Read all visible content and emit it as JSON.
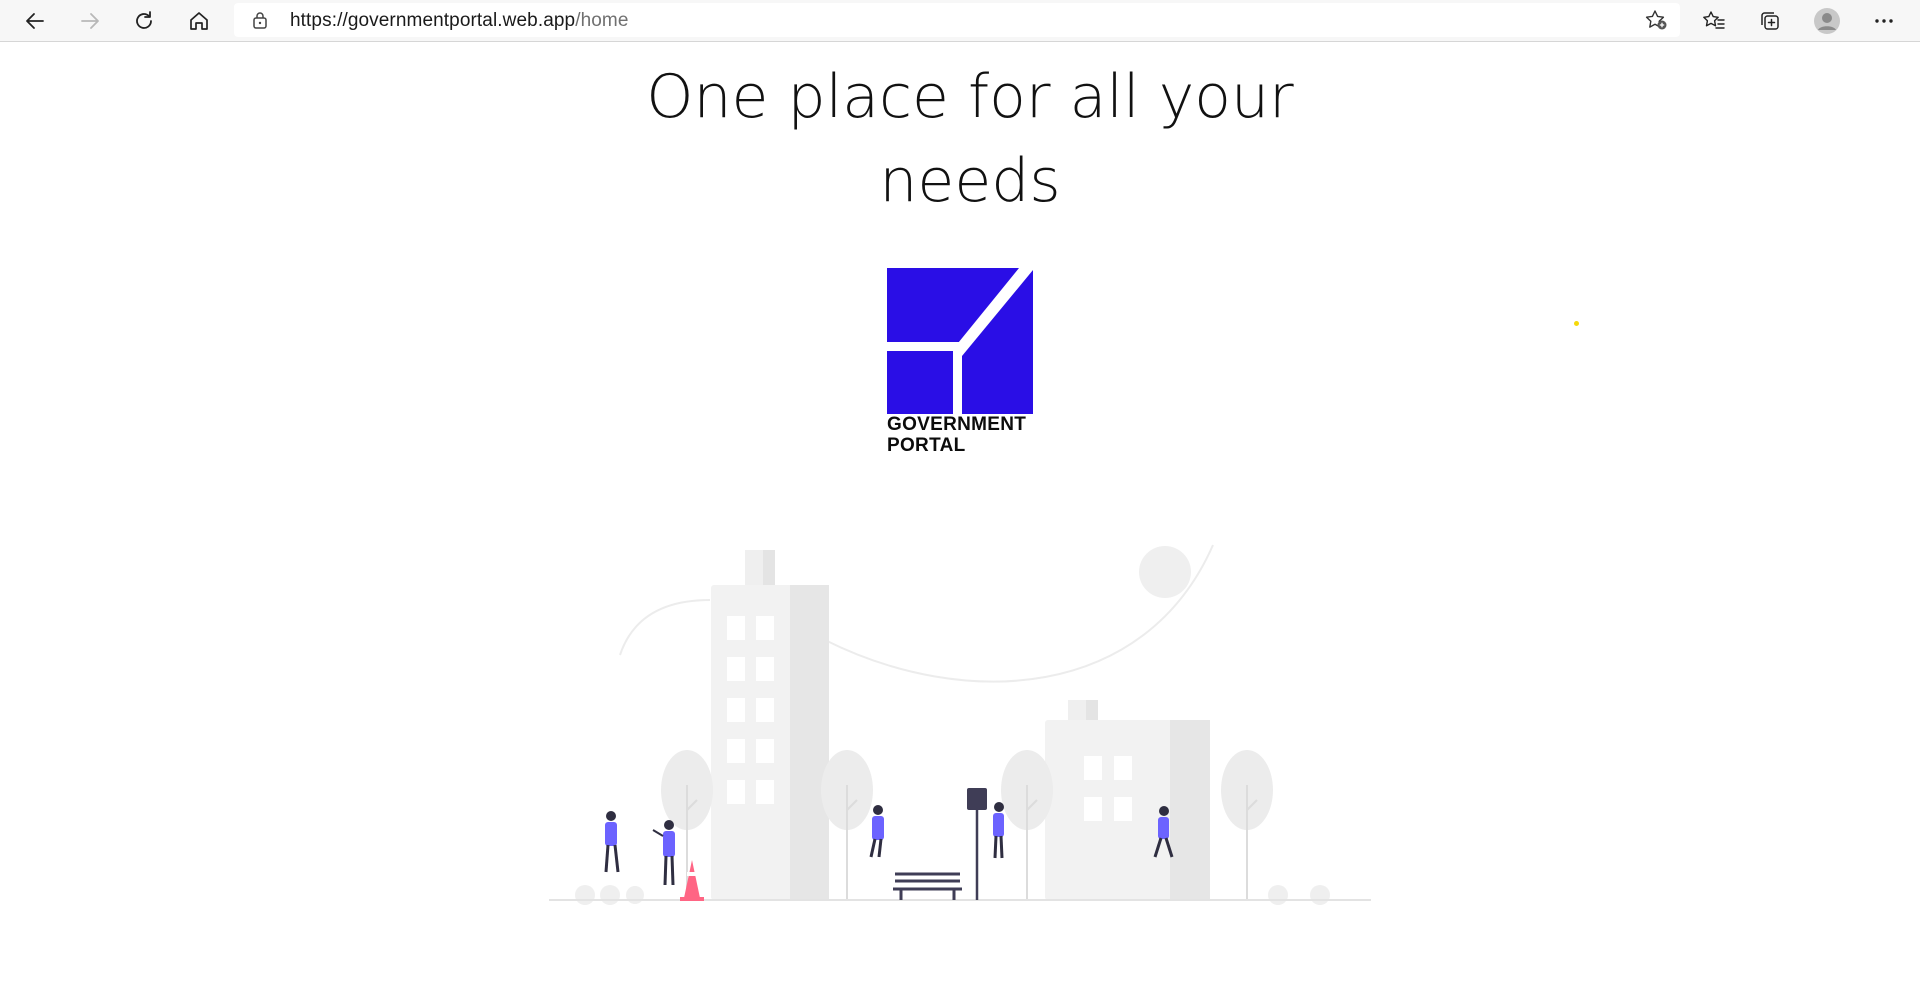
{
  "browser": {
    "url_host": "https://governmentportal.web.app",
    "url_path": "/home",
    "icons": [
      "back-icon",
      "forward-icon",
      "refresh-icon",
      "home-icon",
      "lock-icon",
      "add-favorite-icon",
      "favorites-icon",
      "collections-icon",
      "profile-icon",
      "more-icon"
    ]
  },
  "hero": {
    "headline_line1": "One place for all your",
    "headline_line2": "needs"
  },
  "logo": {
    "text_line1": "GOVERNMENT",
    "text_line2": "PORTAL",
    "color": "#2a0ee6"
  },
  "illustration": {
    "accent_color": "#6c63ff",
    "cone_color": "#ff6584"
  }
}
